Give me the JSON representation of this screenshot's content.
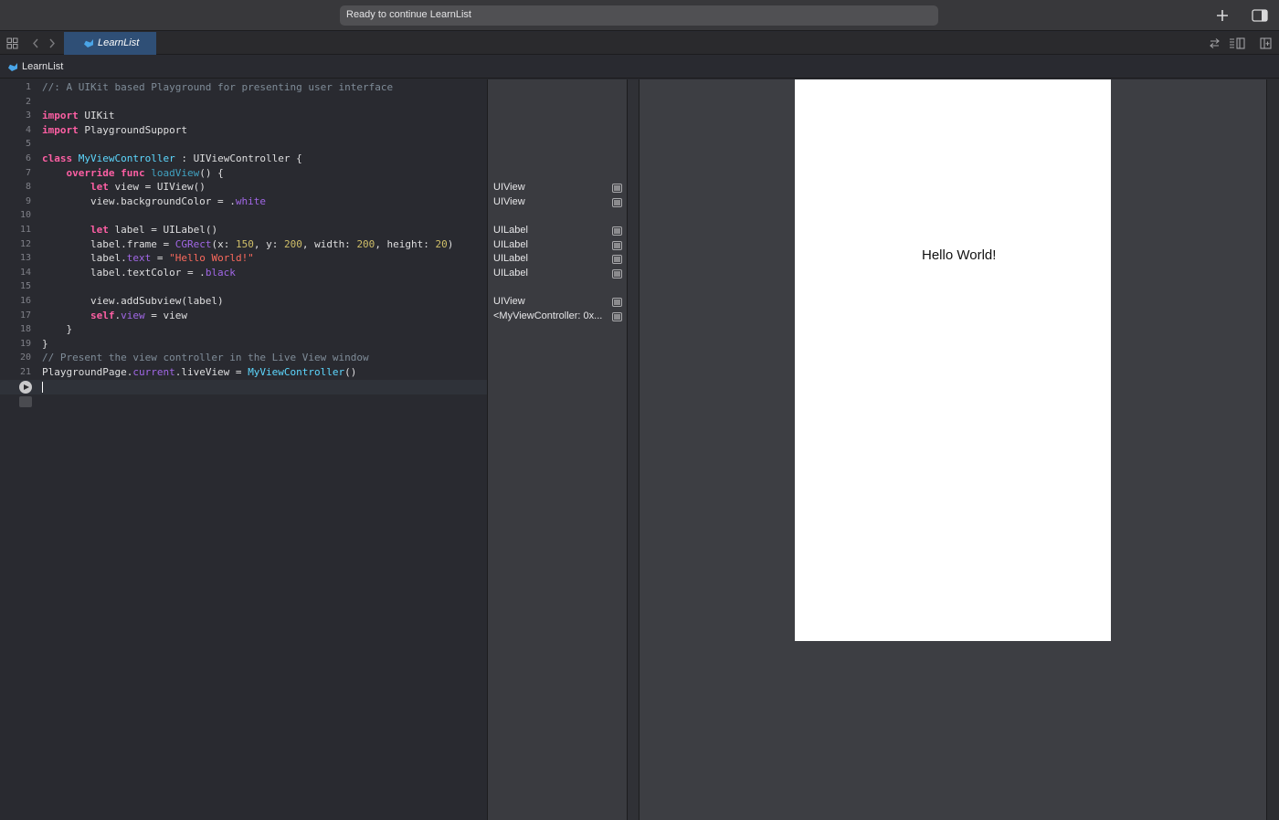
{
  "toolbar": {
    "status": "Ready to continue LearnList",
    "add_icon": "plus-icon",
    "sidebar_icon": "sidebar-toggle-icon"
  },
  "tabbar": {
    "grid_icon": "grid-icon",
    "back_icon": "chevron-left-icon",
    "forward_icon": "chevron-right-icon",
    "active_tab": "LearnList",
    "right_icons": [
      "swap-icon",
      "list-lines-icon",
      "add-editor-icon"
    ]
  },
  "jumpbar": {
    "file": "LearnList"
  },
  "editor": {
    "line_numbers": [
      "1",
      "2",
      "3",
      "4",
      "5",
      "6",
      "7",
      "8",
      "9",
      "10",
      "11",
      "12",
      "13",
      "14",
      "15",
      "16",
      "17",
      "18",
      "19",
      "20",
      "21"
    ],
    "lines": [
      "//: A UIKit based Playground for presenting user interface",
      "",
      "import UIKit",
      "import PlaygroundSupport",
      "",
      "class MyViewController : UIViewController {",
      "    override func loadView() {",
      "        let view = UIView()",
      "        view.backgroundColor = .white",
      "",
      "        let label = UILabel()",
      "        label.frame = CGRect(x: 150, y: 200, width: 200, height: 20)",
      "        label.text = \"Hello World!\"",
      "        label.textColor = .black",
      "",
      "        view.addSubview(label)",
      "        self.view = view",
      "    }",
      "}",
      "// Present the view controller in the Live View window",
      "PlaygroundPage.current.liveView = MyViewController()"
    ]
  },
  "results": [
    {
      "line": 8,
      "text": "UIView"
    },
    {
      "line": 9,
      "text": "UIView"
    },
    {
      "line": 11,
      "text": "UILabel"
    },
    {
      "line": 12,
      "text": "UILabel"
    },
    {
      "line": 13,
      "text": "UILabel"
    },
    {
      "line": 14,
      "text": "UILabel"
    },
    {
      "line": 16,
      "text": "UIView"
    },
    {
      "line": 17,
      "text": "<MyViewController: 0x..."
    }
  ],
  "liveview": {
    "label": "Hello World!",
    "background": "#ffffff"
  },
  "colors": {
    "keyword": "#fc5fa3",
    "comment": "#7f8c98",
    "string": "#fc6a5d",
    "number": "#d0bf69",
    "type": "#5dd8ff",
    "property": "#a167e6",
    "accent_tab": "#2f4f76"
  }
}
